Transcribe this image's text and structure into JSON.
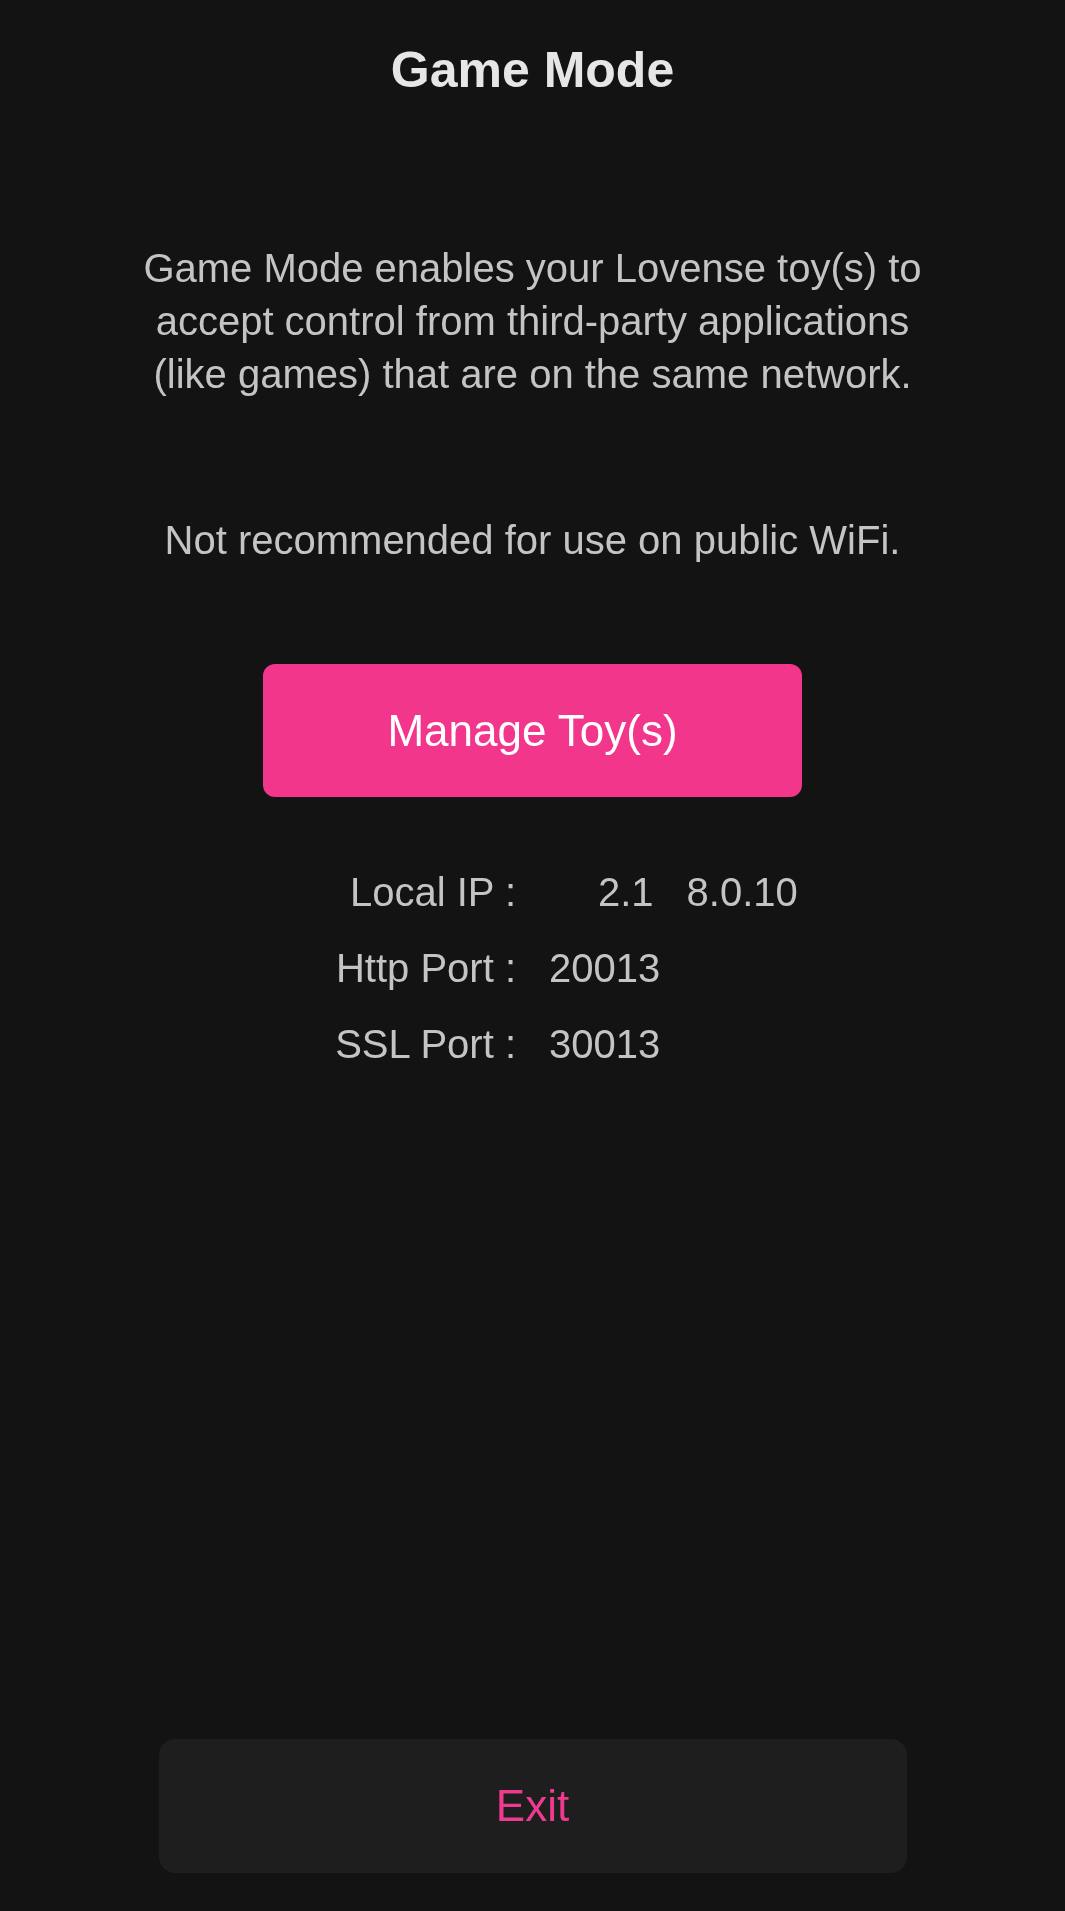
{
  "header": {
    "title": "Game Mode"
  },
  "description": "Game Mode enables your Lovense toy(s) to accept control from third-party applications (like games) that are on the same network.",
  "warning": "Not recommended for use on public WiFi.",
  "primary_button": {
    "label": "Manage Toy(s)"
  },
  "connection_info": [
    {
      "label": "Local IP :",
      "value_fragments": [
        "2.1",
        "8.0.10"
      ],
      "redacted": true
    },
    {
      "label": "Http Port :",
      "value_fragments": [
        "20013"
      ],
      "redacted": false
    },
    {
      "label": "SSL Port :",
      "value_fragments": [
        "30013"
      ],
      "redacted": false
    }
  ],
  "exit_button": {
    "label": "Exit"
  }
}
